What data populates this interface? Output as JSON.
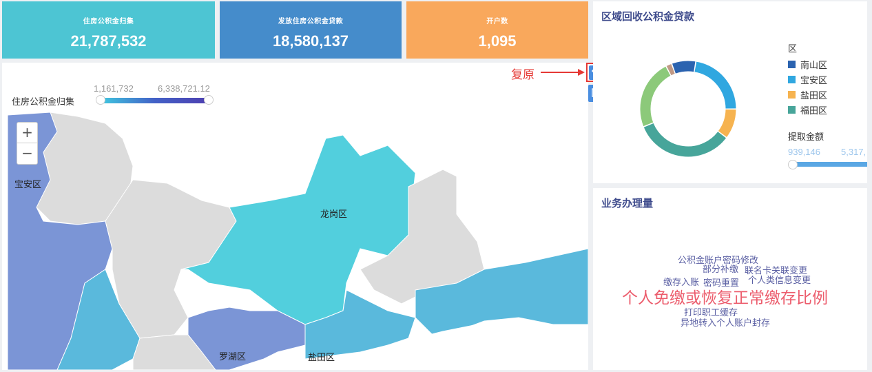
{
  "kpis": [
    {
      "label": "住房公积金归集",
      "value": "21,787,532",
      "color": "#4dc5d3"
    },
    {
      "label": "发放住房公积金贷款",
      "value": "18,580,137",
      "color": "#458ccb"
    },
    {
      "label": "开户数",
      "value": "1,095",
      "color": "#f9a85c"
    }
  ],
  "map": {
    "visualmap_title": "住房公积金归集",
    "visualmap_min": "1,161,732",
    "visualmap_max": "6,338,721.12",
    "zoom_in": "+",
    "zoom_out": "−",
    "regions": [
      {
        "name": "宝安区",
        "color": "#7b95d6"
      },
      {
        "name": "龙岗区",
        "color": "#52cfdd"
      },
      {
        "name": "罗湖区",
        "color": "#7b95d6"
      },
      {
        "name": "盐田区",
        "color": "#5ab9dc"
      }
    ],
    "unlabeled_region_color": "#dcdcdc"
  },
  "toolbox": {
    "restore_icon": "restore-icon",
    "save_icon": "save-image-icon",
    "annotation": "复原"
  },
  "donut": {
    "title": "区域回收公积金贷款",
    "legend_title": "区",
    "legend": [
      {
        "name": "南山区",
        "color": "#2b63b0"
      },
      {
        "name": "宝安区",
        "color": "#30a7e0"
      },
      {
        "name": "盐田区",
        "color": "#f6b350"
      },
      {
        "name": "福田区",
        "color": "#47a59a"
      }
    ],
    "visualmap_title": "提取金额",
    "visualmap_min": "939,146",
    "visualmap_max": "5,317,"
  },
  "chart_data": {
    "type": "pie",
    "title": "区域回收公积金贷款",
    "series": [
      {
        "name": "南山区",
        "value": 8,
        "color": "#2b63b0"
      },
      {
        "name": "宝安区",
        "value": 22,
        "color": "#30a7e0"
      },
      {
        "name": "盐田区",
        "value": 10,
        "color": "#f6b350"
      },
      {
        "name": "福田区",
        "value": 33,
        "color": "#47a59a"
      },
      {
        "name": "",
        "value": 23,
        "color": "#8cc97a"
      },
      {
        "name": "",
        "value": 2,
        "color": "#c09985"
      }
    ]
  },
  "wordcloud": {
    "title": "业务办理量",
    "words": [
      {
        "text": "公积金账户密码修改",
        "big": false
      },
      {
        "text": "部分补缴",
        "big": false
      },
      {
        "text": "联名卡关联变更",
        "big": false
      },
      {
        "text": "缴存入账",
        "big": false
      },
      {
        "text": "密码重置",
        "big": false
      },
      {
        "text": "个人类信息变更",
        "big": false
      },
      {
        "text": "个人免缴或恢复正常缴存比例",
        "big": true
      },
      {
        "text": "打印职工缓存",
        "big": false
      },
      {
        "text": "异地转入个人账户封存",
        "big": false
      }
    ]
  }
}
